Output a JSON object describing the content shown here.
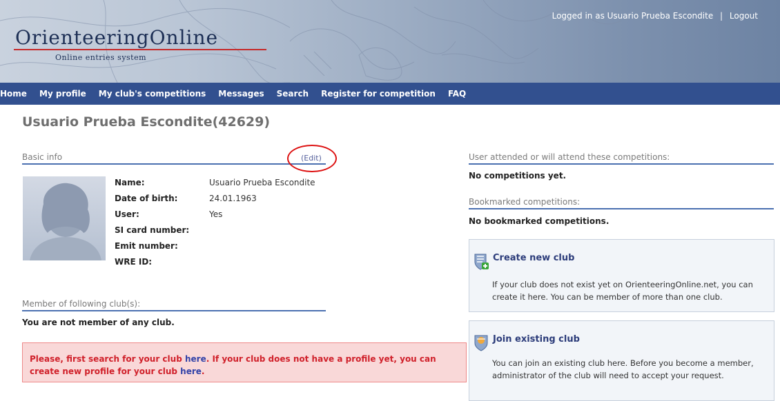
{
  "header": {
    "logo_main": "OrienteeringOnline",
    "logo_sub": "Online entries system",
    "logged_in_text": "Logged in as Usuario Prueba Escondite",
    "separator": "|",
    "logout_label": "Logout"
  },
  "nav": {
    "items": [
      {
        "label": "Home"
      },
      {
        "label": "My profile"
      },
      {
        "label": "My club's competitions"
      },
      {
        "label": "Messages"
      },
      {
        "label": "Search"
      },
      {
        "label": "Register for competition"
      },
      {
        "label": "FAQ"
      }
    ]
  },
  "page": {
    "title": "Usuario Prueba Escondite(42629)"
  },
  "basic_info": {
    "heading": "Basic info",
    "edit_label": "(Edit)",
    "fields": [
      {
        "label": "Name:",
        "value": "Usuario Prueba Escondite"
      },
      {
        "label": "Date of birth:",
        "value": "24.01.1963"
      },
      {
        "label": "User:",
        "value": "Yes"
      },
      {
        "label": "SI card number:",
        "value": ""
      },
      {
        "label": "Emit number:",
        "value": ""
      },
      {
        "label": "WRE ID:",
        "value": ""
      }
    ]
  },
  "clubs": {
    "heading": "Member of following club(s):",
    "empty_text": "You are not member of any club.",
    "warning_part1": "Please, first search for your club ",
    "warning_link1": "here",
    "warning_part2": ". If your club does not have a profile yet, you can create new profile for your club ",
    "warning_link2": "here",
    "warning_part3": "."
  },
  "competitions": {
    "heading": "User attended or will attend these competitions:",
    "empty_text": "No competitions yet."
  },
  "bookmarks": {
    "heading": "Bookmarked competitions:",
    "empty_text": "No bookmarked competitions."
  },
  "create_club": {
    "title": "Create new club",
    "text": "If your club does not exist yet on OrienteeringOnline.net, you can create it here. You can be member of more than one club."
  },
  "join_club": {
    "title": "Join existing club",
    "text": "You can join an existing club here. Before you become a member, administrator of the club will need to accept your request."
  },
  "colors": {
    "nav_bg": "#32508f",
    "accent_line": "#4a6fb0",
    "warning_text": "#d0202a",
    "warning_bg": "#f9d8d8"
  }
}
